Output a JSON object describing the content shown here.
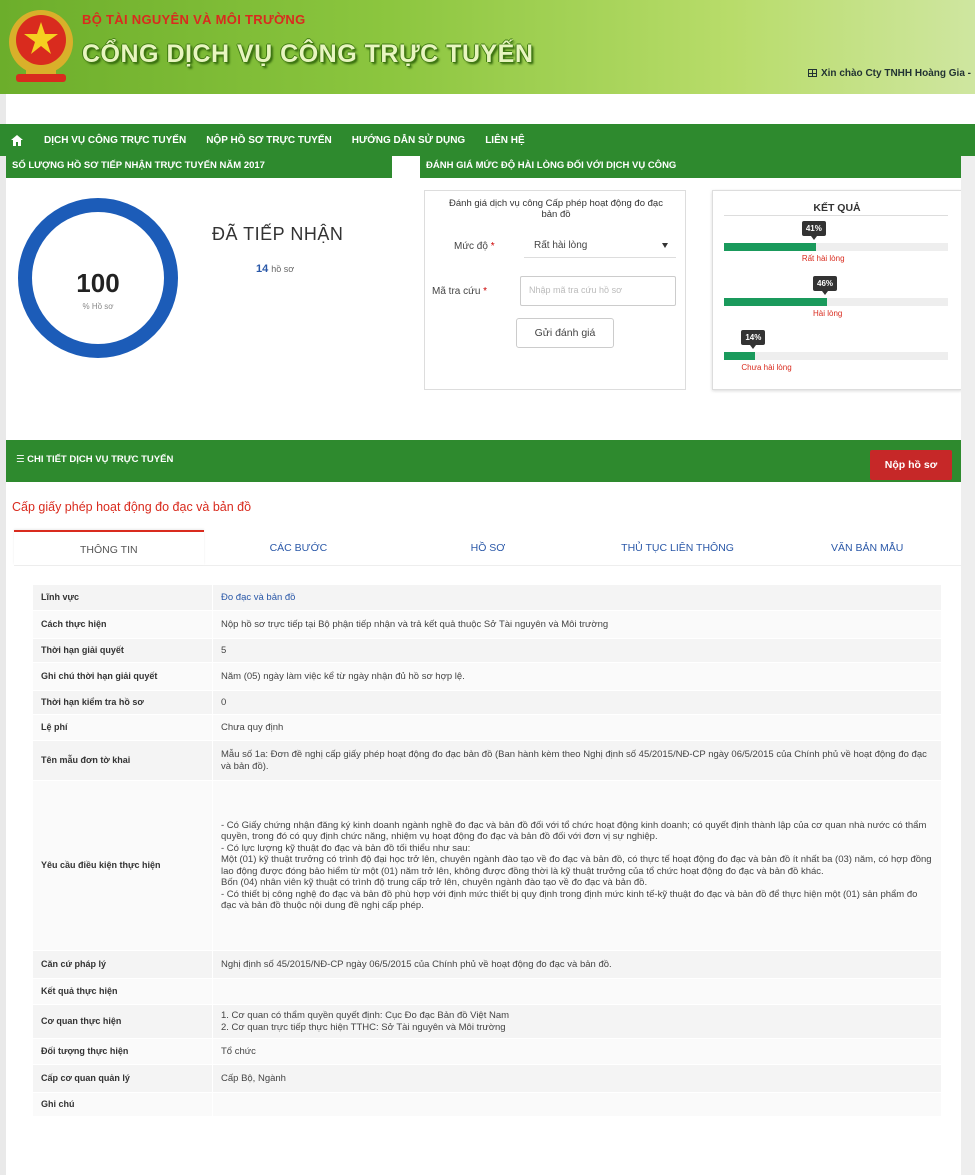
{
  "header": {
    "org_name": "BỘ TÀI NGUYÊN VÀ MÔI TRƯỜNG",
    "portal_title": "CỔNG DỊCH VỤ CÔNG TRỰC TUYẾN",
    "greeting": "Xin chào Cty TNHH Hoàng Gia -",
    "brand_color": "#2e8a2e"
  },
  "nav": {
    "home_icon": "home-icon",
    "items": [
      {
        "label": "DỊCH VỤ CÔNG TRỰC TUYẾN"
      },
      {
        "label": "NỘP HỒ SƠ TRỰC TUYẾN"
      },
      {
        "label": "HƯỚNG DẪN SỬ DỤNG"
      },
      {
        "label": "LIÊN HỆ"
      }
    ]
  },
  "stats": {
    "header": "SỐ LƯỢNG HỒ SƠ TIẾP NHẬN TRỰC TUYẾN NĂM 2017",
    "ring_value": "100",
    "ring_caption": "% Hồ sơ",
    "received_title": "ĐÃ TIẾP NHẬN",
    "received_count": "14",
    "received_unit": "hồ sơ"
  },
  "evaluation": {
    "header": "ĐÁNH GIÁ MỨC ĐỘ HÀI LÒNG ĐỐI VỚI DỊCH VỤ CÔNG",
    "title": "Đánh giá dịch vụ công Cấp phép hoạt động đo đạc bản đồ",
    "level_label": "Mức độ",
    "level_value": "Rất hài lòng",
    "code_label": "Mã tra cứu",
    "code_placeholder": "Nhập mã tra cứu hồ sơ",
    "submit_label": "Gửi đánh giá",
    "required_mark": "*"
  },
  "results": {
    "title": "KẾT QUẢ",
    "items": [
      {
        "percent": 41,
        "badge": "41%",
        "label": "Rất hài lòng"
      },
      {
        "percent": 46,
        "badge": "46%",
        "label": "Hài lòng"
      },
      {
        "percent": 14,
        "badge": "14%",
        "label": "Chưa hài lòng"
      }
    ]
  },
  "detail": {
    "header": "CHI TIẾT DỊCH VỤ TRỰC TUYẾN",
    "submit_button": "Nộp hồ sơ",
    "procedure_title": "Cấp giấy phép hoạt động đo đạc và bản đồ",
    "tabs": [
      {
        "label": "THÔNG TIN",
        "active": true
      },
      {
        "label": "CÁC BƯỚC"
      },
      {
        "label": "HỒ SƠ"
      },
      {
        "label": "THỦ TỤC LIÊN THÔNG"
      },
      {
        "label": "VĂN BẢN MẪU"
      }
    ],
    "rows": [
      {
        "key": "Lĩnh vực",
        "value": "Đo đạc và bản đồ"
      },
      {
        "key": "Cách thực hiện",
        "value": "Nộp hồ sơ trực tiếp tại Bộ phận tiếp nhận và trả kết quả thuộc Sở Tài nguyên và Môi trường"
      },
      {
        "key": "Thời hạn giải quyết",
        "value": "5"
      },
      {
        "key": "Ghi chú thời hạn giải quyết",
        "value": "Năm (05) ngày làm việc kể từ ngày nhận đủ hồ sơ hợp lệ."
      },
      {
        "key": "Thời hạn kiểm tra hồ sơ",
        "value": "0"
      },
      {
        "key": "Lệ phí",
        "value": "Chưa quy định"
      },
      {
        "key": "Tên mẫu đơn tờ khai",
        "value": "Mẫu số 1a: Đơn đề nghị cấp giấy phép hoạt động đo đạc bản đồ (Ban hành kèm theo Nghị định số 45/2015/NĐ-CP ngày 06/5/2015 của Chính phủ về hoạt động đo đạc và bản đồ)."
      },
      {
        "key": "Yêu cầu điều kiện thực hiện",
        "value": "- Có Giấy chứng nhận đăng ký kinh doanh ngành nghề đo đạc và bản đồ đối với tổ chức hoạt động kinh doanh; có quyết định thành lập của cơ quan nhà nước có thẩm quyền, trong đó có quy định chức năng, nhiệm vụ hoạt động đo đạc và bản đồ đối với đơn vị sự nghiệp.\n- Có lực lượng kỹ thuật đo đạc và bản đồ tối thiểu như sau:\nMột (01) kỹ thuật trưởng có trình độ đại học trở lên, chuyên ngành đào tạo về đo đạc và bản đồ, có thực tế hoạt động đo đạc và bản đồ ít nhất ba (03) năm, có hợp đồng lao động được đóng bảo hiểm từ một (01) năm trở lên, không được đồng thời là kỹ thuật trưởng của tổ chức hoạt động đo đạc và bản đồ khác.\nBốn (04) nhân viên kỹ thuật có trình độ trung cấp trở lên, chuyên ngành đào tạo về đo đạc và bản đồ.\n- Có thiết bị công nghệ đo đạc và bản đồ phù hợp với định mức thiết bị quy định trong định mức kinh tế-kỹ thuật đo đạc và bản đồ để thực hiện một (01) sản phẩm đo đạc và bản đồ thuộc nội dung đề nghị cấp phép."
      },
      {
        "key": "Căn cứ pháp lý",
        "value": "Nghị định số 45/2015/NĐ-CP ngày 06/5/2015 của Chính phủ về hoạt động đo đạc và bản đồ."
      },
      {
        "key": "Kết quả thực hiện",
        "value": ""
      },
      {
        "key": "Cơ quan thực hiện",
        "value": "1. Cơ quan có thẩm quyền quyết định: Cục Đo đạc Bản đồ Việt Nam\n2. Cơ quan trực tiếp thực hiện TTHC: Sở Tài nguyên và Môi trường"
      },
      {
        "key": "Đối tượng thực hiện",
        "value": "Tổ chức"
      },
      {
        "key": "Cấp cơ quan quản lý",
        "value": "Cấp Bộ, Ngành"
      },
      {
        "key": "Ghi chú",
        "value": ""
      }
    ]
  }
}
